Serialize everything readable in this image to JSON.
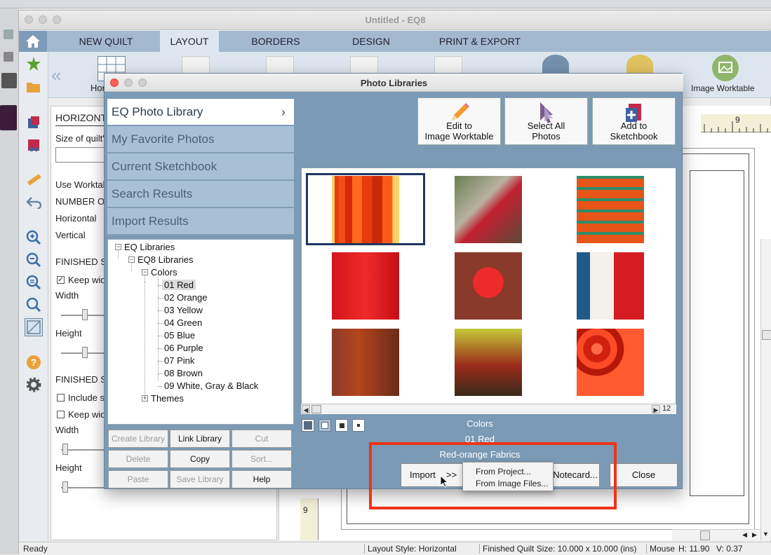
{
  "main_window": {
    "title": "Untitled - EQ8",
    "tabs": [
      {
        "label": "NEW QUILT"
      },
      {
        "label": "LAYOUT"
      },
      {
        "label": "BORDERS"
      },
      {
        "label": "DESIGN"
      },
      {
        "label": "PRINT & EXPORT"
      }
    ],
    "ribbon": {
      "collapse_label": "«",
      "partial_label": "Hor",
      "image_worktable_label": "Image Worktable"
    },
    "left_panel": {
      "header": "HORIZONT",
      "size_label": "Size of quilt's",
      "use_worktable": "Use Worktab",
      "number_of": "NUMBER OF",
      "horizontal": "Horizontal",
      "vertical": "Vertical",
      "finished1": "FINISHED SI",
      "keep_width1": "Keep wid",
      "width1": "Width",
      "height1": "Height",
      "finished2": "FINISHED SI",
      "include": "Include s",
      "keep_width2": "Keep wid",
      "width2": "Width",
      "height2": "Height"
    },
    "ruler_number": "9",
    "left_ruler_number": "9",
    "status": {
      "ready": "Ready",
      "layout_style": "Layout Style: Horizontal",
      "finished_size": "Finished Quilt Size: 10.000 x 10.000 (ins)",
      "mouse": "Mouse",
      "h": "H:  11.90",
      "v": "V:  0.37"
    }
  },
  "dialog": {
    "title": "Photo Libraries",
    "libraries": [
      {
        "label": "EQ Photo Library",
        "active": true
      },
      {
        "label": "My Favorite Photos"
      },
      {
        "label": "Current Sketchbook"
      },
      {
        "label": "Search Results"
      },
      {
        "label": "Import Results"
      }
    ],
    "chevron": "›",
    "tree": {
      "root": "EQ Libraries",
      "sub": "EQ8 Libraries",
      "colors": "Colors",
      "items": [
        "01 Red",
        "02 Orange",
        "03 Yellow",
        "04 Green",
        "05 Blue",
        "06 Purple",
        "07 Pink",
        "08 Brown",
        "09 White, Gray & Black"
      ],
      "themes": "Themes",
      "expander_open": "−",
      "expander_closed": "+"
    },
    "lib_buttons": {
      "create_library": "Create Library",
      "link_library": "Link Library",
      "cut": "Cut",
      "delete": "Delete",
      "copy": "Copy",
      "sort": "Sort...",
      "paste": "Paste",
      "save_library": "Save Library",
      "help": "Help"
    },
    "top_buttons": {
      "edit_line1": "Edit to",
      "edit_line2": "Image Worktable",
      "select_line1": "Select All",
      "select_line2": "Photos",
      "add_line1": "Add to",
      "add_line2": "Sketchbook"
    },
    "scroll_count": "12",
    "info": {
      "category": "Colors",
      "subcategory": "01 Red",
      "name": "Red-orange Fabrics"
    },
    "bottom_buttons": {
      "import": "Import",
      "arrows": ">>",
      "notecard": "Notecard...",
      "close": "Close"
    },
    "import_menu": {
      "from_project": "From Project...",
      "from_image_files": "From Image Files..."
    }
  },
  "colors": {
    "dialog_bg": "#7a9ab6",
    "highlight": "#ee3417",
    "selection_border": "#1f3561"
  }
}
